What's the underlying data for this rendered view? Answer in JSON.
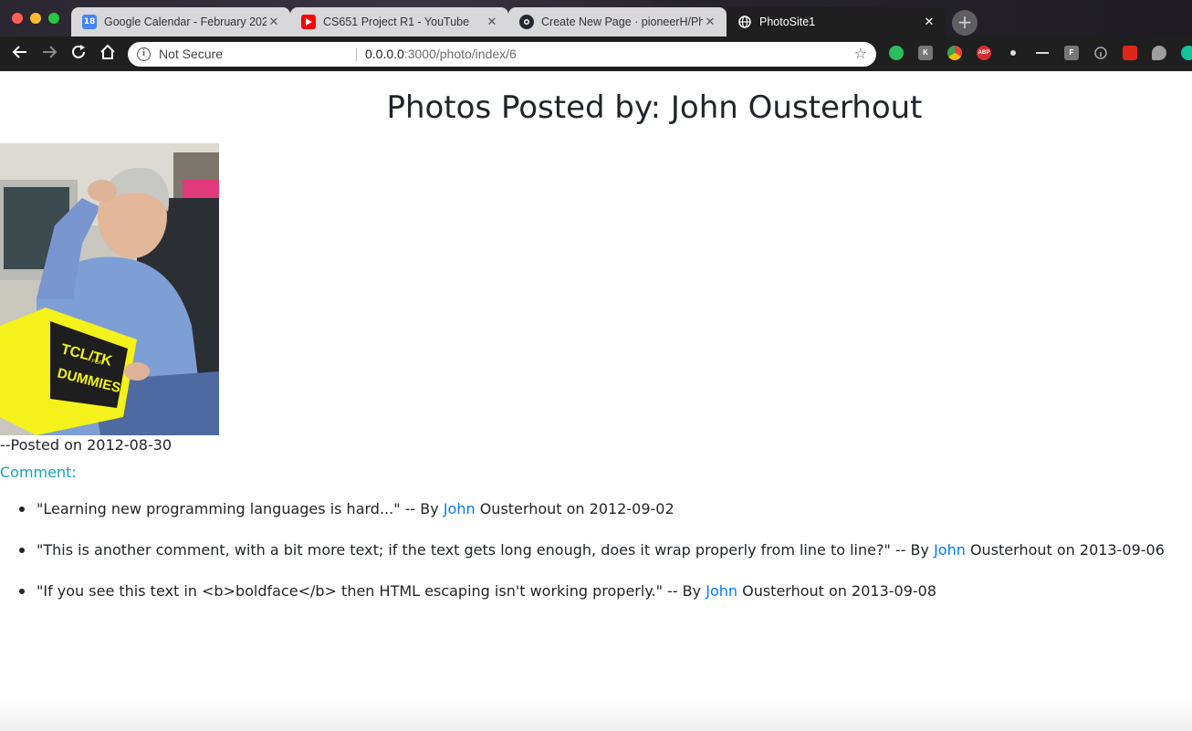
{
  "browser": {
    "tabs": [
      {
        "title": "Google Calendar - February 202",
        "favicon": "calendar-icon",
        "favicon_text": "18",
        "active": false
      },
      {
        "title": "CS651 Project R1 - YouTube",
        "favicon": "youtube-icon",
        "active": false
      },
      {
        "title": "Create New Page · pioneerH/Pho",
        "favicon": "github-icon",
        "active": false
      },
      {
        "title": "PhotoSite1",
        "favicon": "globe-icon",
        "active": true
      }
    ],
    "address_bar": {
      "security_label": "Not Secure",
      "url_host": "0.0.0.0",
      "url_path": ":3000/photo/index/6"
    },
    "extensions": [
      {
        "name": "evernote-icon",
        "color": "#2dbe60"
      },
      {
        "name": "k-extension-icon",
        "color": "#777777"
      },
      {
        "name": "chrome-extension-icon",
        "color": "#f4b400"
      },
      {
        "name": "adblock-plus-icon",
        "color": "#d32f2f"
      },
      {
        "name": "record-icon",
        "color": "#555555"
      },
      {
        "name": "dots-extension-icon",
        "color": "#555555"
      },
      {
        "name": "f-extension-icon",
        "color": "#777777"
      },
      {
        "name": "info-extension-icon",
        "color": "#555555"
      },
      {
        "name": "acrobat-icon",
        "color": "#e0261b"
      },
      {
        "name": "chat-bubble-icon",
        "color": "#9e9e9e"
      },
      {
        "name": "grammarly-icon",
        "color": "#15c39a"
      }
    ]
  },
  "page": {
    "title": "Photos Posted by: John Ousterhout",
    "photo": {
      "alt": "John Ousterhout reading a TCL/TK for Dummies book",
      "book_text_1": "TCL/TK",
      "book_text_2": "FOR",
      "book_text_3": "DUMMIES"
    },
    "posted": "--Posted on 2012-08-30",
    "comment_label": "Comment:",
    "comments": [
      {
        "text": "\"Learning new programming languages is hard...\" -- By ",
        "author_first": "John",
        "author_rest": " Ousterhout on 2012-09-02"
      },
      {
        "text": "\"This is another comment, with a bit more text; if the text gets long enough, does it wrap properly from line to line?\" -- By ",
        "author_first": "John",
        "author_rest": " Ousterhout on 2013-09-06"
      },
      {
        "text": "\"If you see this text in <b>boldface</b> then HTML escaping isn't working properly.\" -- By ",
        "author_first": "John",
        "author_rest": " Ousterhout on 2013-09-08"
      }
    ]
  },
  "colors": {
    "link": "#007bff",
    "comment_label": "#17a2b8",
    "text": "#212529"
  }
}
